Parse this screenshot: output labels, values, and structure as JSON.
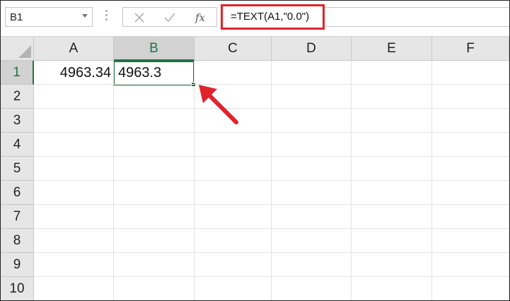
{
  "name_box": {
    "value": "B1"
  },
  "formula_bar": {
    "formula": "=TEXT(A1,\"0.0\")",
    "cancel_icon": "close-icon",
    "enter_icon": "check-icon",
    "fx_icon": "fx-icon"
  },
  "columns": [
    "A",
    "B",
    "C",
    "D",
    "E",
    "F"
  ],
  "rows": [
    "1",
    "2",
    "3",
    "4",
    "5",
    "6",
    "7",
    "8",
    "9",
    "10"
  ],
  "cells": {
    "A1": "4963.34",
    "B1": "4963.3"
  },
  "selected_cell": "B1",
  "colors": {
    "accent_green": "#217346",
    "highlight_red": "#e0232c",
    "header_gray": "#e6e6e6"
  }
}
